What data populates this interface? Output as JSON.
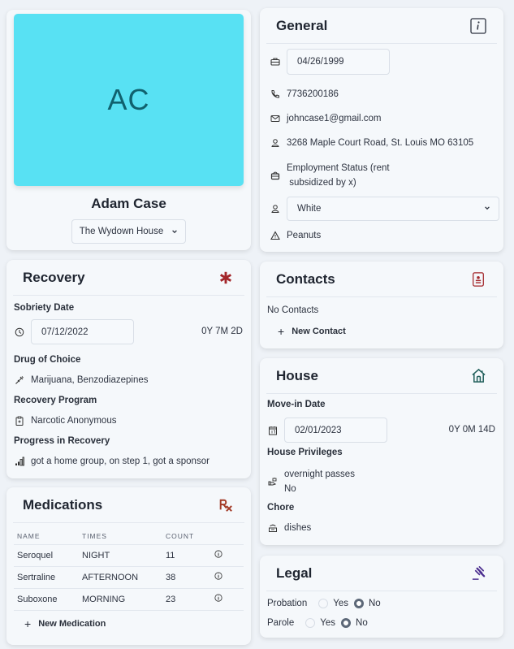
{
  "profile": {
    "initials": "AC",
    "avatar_color": "#58e1f3",
    "name": "Adam Case",
    "house_select": "The Wydown House"
  },
  "general": {
    "title": "General",
    "header_icon": "info-icon",
    "birth_date": "04/26/1999",
    "phone": "7736200186",
    "email": "johncase1@gmail.com",
    "address": "3268 Maple Court Road, St. Louis MO 63105",
    "employment_line1": "Employment Status (rent",
    "employment_line2": " subsidized by x)",
    "race_select": "White",
    "allergy": "Peanuts"
  },
  "recovery": {
    "title": "Recovery",
    "header_icon": "asterisk-icon",
    "accent": "#a3262a",
    "sobriety_label": "Sobriety Date",
    "sobriety_date": "07/12/2022",
    "sobriety_duration": "0Y 7M 2D",
    "drug_label": "Drug of Choice",
    "drug_value": "Marijuana, Benzodiazepines",
    "program_label": "Recovery Program",
    "program_value": "Narcotic Anonymous",
    "progress_label": "Progress in Recovery",
    "progress_value": "got a home group, on step 1, got a sponsor"
  },
  "medications": {
    "title": "Medications",
    "header_icon": "rx-icon",
    "accent": "#a33b28",
    "columns": [
      "NAME",
      "TIMES",
      "COUNT"
    ],
    "rows": [
      {
        "name": "Seroquel",
        "times": "NIGHT",
        "count": "11"
      },
      {
        "name": "Sertraline",
        "times": "AFTERNOON",
        "count": "38"
      },
      {
        "name": "Suboxone",
        "times": "MORNING",
        "count": "23"
      }
    ],
    "add_label": "New Medication"
  },
  "contacts": {
    "title": "Contacts",
    "header_icon": "contact-card-icon",
    "accent": "#a3262a",
    "empty_text": "No Contacts",
    "add_label": "New Contact"
  },
  "house": {
    "title": "House",
    "header_icon": "home-icon",
    "accent": "#1f5e5a",
    "movein_label": "Move-in Date",
    "movein_date": "02/01/2023",
    "movein_duration": "0Y 0M 14D",
    "privileges_label": "House Privileges",
    "privilege_name": "overnight passes",
    "privilege_value": "No",
    "chore_label": "Chore",
    "chore_value": "dishes"
  },
  "legal": {
    "title": "Legal",
    "header_icon": "gavel-icon",
    "accent": "#4b2d8f",
    "probation_label": "Probation",
    "parole_label": "Parole",
    "yes_label": "Yes",
    "no_label": "No",
    "probation_value": "No",
    "parole_value": "No"
  }
}
